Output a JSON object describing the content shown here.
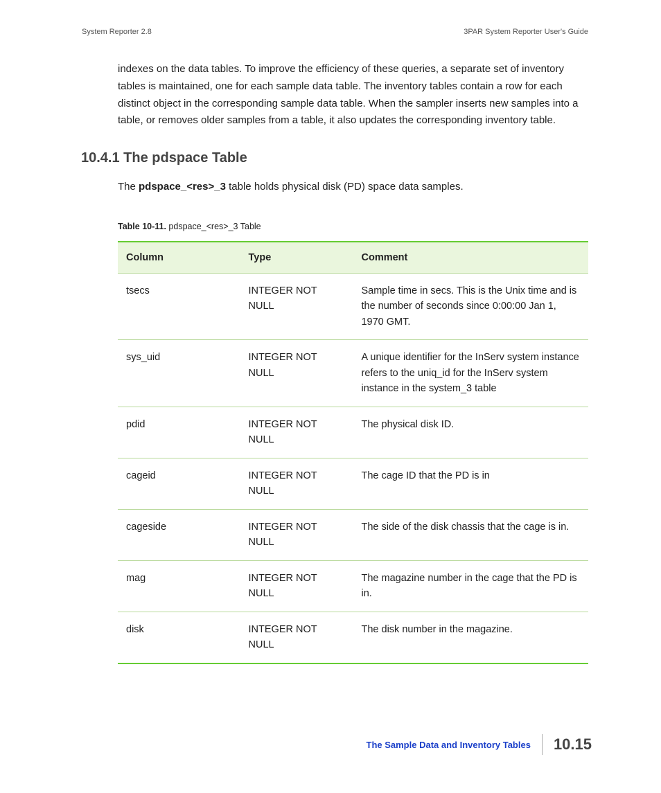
{
  "header": {
    "left": "System Reporter 2.8",
    "right": "3PAR System Reporter User's Guide"
  },
  "intro_paragraph": "indexes on the data tables. To improve the efficiency of these queries, a separate set of inventory tables is maintained, one for each sample data table. The inventory tables contain a row for each distinct object in the corresponding sample data table. When the sampler inserts new samples into a table, or removes older samples from a table, it also updates the corresponding inventory table.",
  "section": {
    "number_title": "10.4.1 The pdspace Table",
    "intro_prefix": "The ",
    "intro_bold": "pdspace_<res>_3",
    "intro_suffix": " table holds physical disk (PD) space data samples."
  },
  "table_caption": {
    "label": "Table 10-11.",
    "text": "  pdspace_<res>_3 Table"
  },
  "table": {
    "headers": {
      "c1": "Column",
      "c2": "Type",
      "c3": "Comment"
    },
    "rows": [
      {
        "c1": "tsecs",
        "c2": "INTEGER NOT NULL",
        "c3": "Sample time in secs. This is the Unix time and is the number of seconds since 0:00:00 Jan 1, 1970 GMT."
      },
      {
        "c1": "sys_uid",
        "c2": "INTEGER NOT NULL",
        "c3": "A unique identifier for the InServ system instance refers to the uniq_id for the InServ system instance in the system_3 table"
      },
      {
        "c1": "pdid",
        "c2": "INTEGER NOT NULL",
        "c3": "The physical disk ID."
      },
      {
        "c1": "cageid",
        "c2": "INTEGER NOT NULL",
        "c3": "The cage ID that the PD is in"
      },
      {
        "c1": "cageside",
        "c2": "INTEGER NOT NULL",
        "c3": "The side of the disk chassis that the cage is in."
      },
      {
        "c1": "mag",
        "c2": "INTEGER NOT NULL",
        "c3": "The magazine number in the cage that the PD is in."
      },
      {
        "c1": "disk",
        "c2": "INTEGER NOT NULL",
        "c3": "The disk number in the magazine."
      }
    ]
  },
  "footer": {
    "link_text": "The Sample Data and Inventory Tables",
    "page_number": "10.15"
  }
}
